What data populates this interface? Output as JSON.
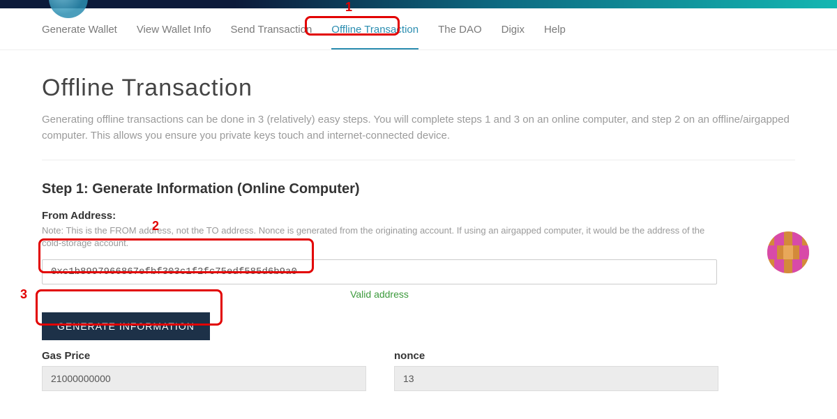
{
  "nav": {
    "tabs": [
      {
        "label": "Generate Wallet"
      },
      {
        "label": "View Wallet Info"
      },
      {
        "label": "Send Transaction"
      },
      {
        "label": "Offline Transaction",
        "active": true
      },
      {
        "label": "The DAO"
      },
      {
        "label": "Digix"
      },
      {
        "label": "Help"
      }
    ]
  },
  "page": {
    "title": "Offline Transaction",
    "intro": "Generating offline transactions can be done in 3 (relatively) easy steps. You will complete steps 1 and 3 on an online computer, and step 2 on an offline/airgapped computer. This allows you ensure you private keys touch and internet-connected device."
  },
  "step1": {
    "title": "Step 1: Generate Information (Online Computer)",
    "from_label": "From Address:",
    "note": "Note: This is the FROM address, not the TO address. Nonce is generated from the originating account. If using an airgapped computer, it would be the address of the cold-storage account.",
    "address_value": "0xc1b8997966867efbf303c1f2fc75edf585d6b9a0",
    "valid_text": "Valid address",
    "button": "GENERATE INFORMATION",
    "gas_label": "Gas Price",
    "gas_value": "21000000000",
    "nonce_label": "nonce",
    "nonce_value": "13"
  },
  "annotations": {
    "n1": "1",
    "n2": "2",
    "n3": "3"
  }
}
